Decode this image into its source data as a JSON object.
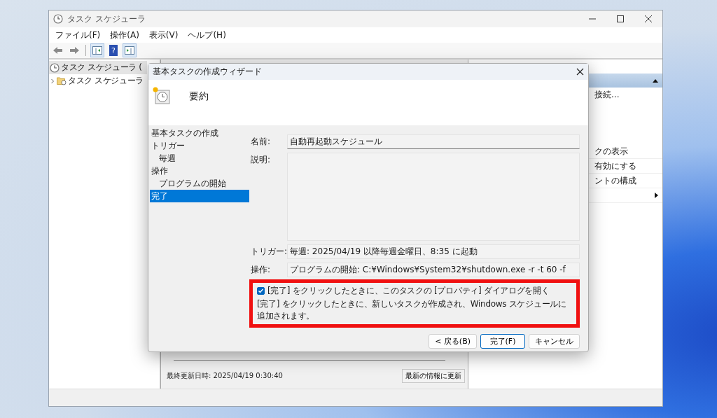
{
  "main_window": {
    "title": "タスク スケジューラ",
    "menu": [
      "ファイル(F)",
      "操作(A)",
      "表示(V)",
      "ヘルプ(H)"
    ],
    "help_glyph": "?",
    "tree": [
      {
        "label": "タスク スケジューラ (",
        "selected": true,
        "children": [
          {
            "label": "タスク スケジューラ",
            "selected": false,
            "expanded": false
          }
        ]
      }
    ],
    "center_footer": {
      "last_updated": "最終更新日時: 2025/04/19 0:30:40",
      "refresh_button": "最新の情報に更新"
    },
    "actions_pane": {
      "items": [
        {
          "kind": "text",
          "label": "接続..."
        },
        {
          "kind": "text",
          "label": "クの表示"
        },
        {
          "kind": "text",
          "label": "有効にする"
        },
        {
          "kind": "text",
          "label": "ントの構成"
        },
        {
          "kind": "submenu"
        }
      ]
    }
  },
  "dialog": {
    "title": "基本タスクの作成ウィザード",
    "heading": "要約",
    "steps": [
      {
        "label": "基本タスクの作成",
        "selected": false
      },
      {
        "label": "トリガー",
        "selected": false,
        "children": [
          {
            "label": "毎週",
            "selected": false
          }
        ]
      },
      {
        "label": "操作",
        "selected": false,
        "children": [
          {
            "label": "プログラムの開始",
            "selected": false
          }
        ]
      },
      {
        "label": "完了",
        "selected": true
      }
    ],
    "fields": [
      {
        "kind": "line",
        "label": "名前:",
        "value": "自動再起動スケジュール"
      },
      {
        "kind": "area",
        "label": "説明:"
      },
      {
        "kind": "line",
        "label": "トリガー:",
        "value": "毎週: 2025/04/19 以降毎週金曜日、8:35 に起動"
      },
      {
        "kind": "line",
        "label": "操作:",
        "value": "プログラムの開始: C:¥Windows¥System32¥shutdown.exe -r -t 60 -f"
      }
    ],
    "open_properties": {
      "label": "[完了] をクリックしたときに、このタスクの [プロパティ] ダイアログを開く",
      "checked": true
    },
    "note": "[完了] をクリックしたときに、新しいタスクが作成され、Windows スケジュールに追加されます。",
    "buttons": [
      {
        "label": "< 戻る(B)",
        "default": false
      },
      {
        "label": "完了(F)",
        "default": true
      },
      {
        "label": "キャンセル",
        "default": false
      }
    ]
  }
}
